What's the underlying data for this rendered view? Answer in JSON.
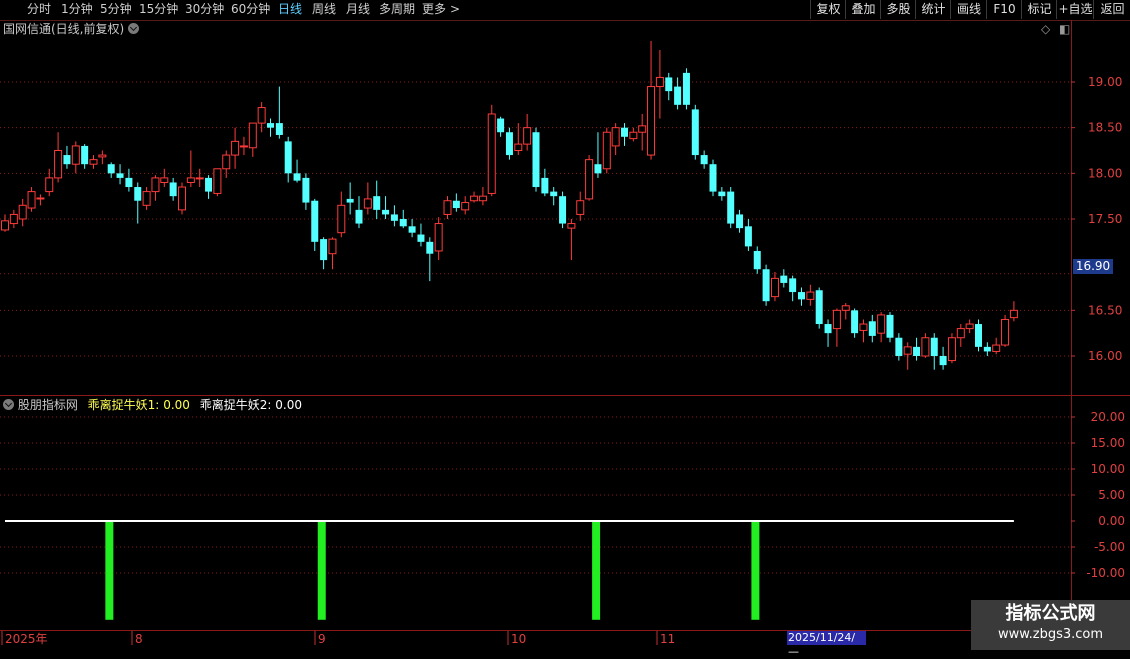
{
  "toolbar": {
    "periods": [
      {
        "label": "分时",
        "active": false
      },
      {
        "label": "1分钟",
        "active": false
      },
      {
        "label": "5分钟",
        "active": false
      },
      {
        "label": "15分钟",
        "active": false
      },
      {
        "label": "30分钟",
        "active": false
      },
      {
        "label": "60分钟",
        "active": false
      },
      {
        "label": "日线",
        "active": true
      },
      {
        "label": "周线",
        "active": false
      },
      {
        "label": "月线",
        "active": false
      },
      {
        "label": "多周期",
        "active": false
      },
      {
        "label": "更多",
        "active": false
      }
    ],
    "more_arrow": ">",
    "buttons": [
      "复权",
      "叠加",
      "多股",
      "统计",
      "画线",
      "F10",
      "标记",
      "+自选",
      "返回"
    ]
  },
  "main_panel": {
    "title": "国网信通(日线,前复权)",
    "price_axis": [
      "19.00",
      "18.50",
      "18.00",
      "17.50",
      "16.90",
      "16.50",
      "16.00"
    ],
    "current_price": "16.90",
    "icons": [
      "diamond-icon",
      "panel-toggle-icon"
    ]
  },
  "indicator_panel": {
    "name": "股朋指标网",
    "line1_label": "乖离捉牛妖1:",
    "line1_value": "0.00",
    "line2_label": "乖离捉牛妖2:",
    "line2_value": "0.00",
    "axis": [
      "20.00",
      "15.00",
      "10.00",
      "5.00",
      "0.00",
      "-5.00",
      "-10.00"
    ]
  },
  "date_axis": {
    "labels": [
      "2025年",
      "8",
      "9",
      "10",
      "11"
    ],
    "cursor": "2025/11/24/—"
  },
  "watermark": {
    "line1": "指标公式网",
    "line2": "www.zbgs3.com"
  },
  "colors": {
    "up": "#ff3b3b",
    "down": "#54ffff",
    "signal": "#22ee22",
    "grid": "#8a1a1a",
    "axis_text": "#e04040",
    "active_tab": "#5fd0ff"
  },
  "chart_data": {
    "type": "candlestick",
    "y_range": [
      15.8,
      19.35
    ],
    "candles": [
      [
        17.38,
        17.48,
        17.36,
        17.55
      ],
      [
        17.45,
        17.55,
        17.4,
        17.6
      ],
      [
        17.5,
        17.65,
        17.42,
        17.72
      ],
      [
        17.62,
        17.8,
        17.58,
        17.85
      ],
      [
        17.72,
        17.73,
        17.65,
        17.77
      ],
      [
        17.8,
        17.95,
        17.75,
        18.05
      ],
      [
        17.95,
        18.25,
        17.9,
        18.45
      ],
      [
        18.2,
        18.1,
        18.05,
        18.3
      ],
      [
        18.1,
        18.3,
        18.0,
        18.35
      ],
      [
        18.3,
        18.1,
        18.05,
        18.32
      ],
      [
        18.1,
        18.15,
        18.05,
        18.2
      ],
      [
        18.18,
        18.2,
        18.1,
        18.25
      ],
      [
        18.1,
        18.0,
        17.95,
        18.12
      ],
      [
        18.0,
        17.95,
        17.88,
        18.1
      ],
      [
        17.95,
        17.85,
        17.8,
        18.05
      ],
      [
        17.85,
        17.7,
        17.45,
        17.9
      ],
      [
        17.65,
        17.8,
        17.6,
        17.85
      ],
      [
        17.8,
        17.95,
        17.7,
        17.98
      ],
      [
        17.9,
        17.95,
        17.85,
        18.05
      ],
      [
        17.9,
        17.75,
        17.7,
        17.95
      ],
      [
        17.6,
        17.85,
        17.55,
        17.9
      ],
      [
        17.9,
        17.95,
        17.85,
        18.25
      ],
      [
        17.95,
        17.95,
        17.85,
        18.05
      ],
      [
        17.95,
        17.8,
        17.72,
        17.98
      ],
      [
        17.78,
        18.05,
        17.75,
        18.05
      ],
      [
        18.05,
        18.2,
        17.95,
        18.25
      ],
      [
        18.2,
        18.35,
        18.05,
        18.5
      ],
      [
        18.3,
        18.3,
        18.2,
        18.4
      ],
      [
        18.28,
        18.55,
        18.18,
        18.55
      ],
      [
        18.55,
        18.72,
        18.45,
        18.78
      ],
      [
        18.55,
        18.5,
        18.4,
        18.6
      ],
      [
        18.55,
        18.42,
        18.38,
        18.95
      ],
      [
        18.35,
        18.0,
        17.9,
        18.4
      ],
      [
        18.0,
        17.92,
        17.9,
        18.15
      ],
      [
        17.95,
        17.68,
        17.6,
        18.0
      ],
      [
        17.7,
        17.25,
        17.15,
        17.72
      ],
      [
        17.28,
        17.05,
        16.95,
        17.3
      ],
      [
        17.12,
        17.28,
        16.95,
        17.3
      ],
      [
        17.35,
        17.65,
        17.3,
        17.8
      ],
      [
        17.72,
        17.68,
        17.55,
        17.9
      ],
      [
        17.6,
        17.45,
        17.4,
        17.75
      ],
      [
        17.62,
        17.72,
        17.55,
        17.9
      ],
      [
        17.75,
        17.6,
        17.5,
        17.92
      ],
      [
        17.6,
        17.55,
        17.5,
        17.75
      ],
      [
        17.55,
        17.48,
        17.42,
        17.65
      ],
      [
        17.5,
        17.42,
        17.4,
        17.6
      ],
      [
        17.42,
        17.35,
        17.3,
        17.5
      ],
      [
        17.33,
        17.25,
        17.2,
        17.45
      ],
      [
        17.25,
        17.12,
        16.82,
        17.3
      ],
      [
        17.15,
        17.45,
        17.05,
        17.52
      ],
      [
        17.55,
        17.7,
        17.5,
        17.75
      ],
      [
        17.7,
        17.62,
        17.58,
        17.78
      ],
      [
        17.6,
        17.68,
        17.55,
        17.75
      ],
      [
        17.7,
        17.75,
        17.68,
        17.8
      ],
      [
        17.7,
        17.75,
        17.65,
        17.85
      ],
      [
        17.78,
        18.65,
        17.75,
        18.75
      ],
      [
        18.6,
        18.45,
        18.4,
        18.62
      ],
      [
        18.45,
        18.2,
        18.15,
        18.5
      ],
      [
        18.25,
        18.32,
        18.2,
        18.55
      ],
      [
        18.32,
        18.5,
        18.25,
        18.65
      ],
      [
        18.45,
        17.85,
        17.8,
        18.5
      ],
      [
        17.95,
        17.78,
        17.75,
        18.05
      ],
      [
        17.8,
        17.75,
        17.65,
        17.85
      ],
      [
        17.75,
        17.45,
        17.4,
        17.8
      ],
      [
        17.4,
        17.45,
        17.05,
        17.5
      ],
      [
        17.55,
        17.7,
        17.48,
        17.8
      ],
      [
        17.72,
        18.15,
        17.7,
        18.2
      ],
      [
        18.1,
        18.0,
        17.95,
        18.45
      ],
      [
        18.05,
        18.45,
        18.0,
        18.5
      ],
      [
        18.3,
        18.5,
        18.2,
        18.55
      ],
      [
        18.5,
        18.4,
        18.3,
        18.55
      ],
      [
        18.38,
        18.45,
        18.35,
        18.5
      ],
      [
        18.45,
        18.52,
        18.25,
        18.65
      ],
      [
        18.2,
        18.95,
        18.15,
        19.45
      ],
      [
        18.95,
        19.05,
        18.6,
        19.35
      ],
      [
        19.05,
        18.9,
        18.8,
        19.1
      ],
      [
        18.95,
        18.75,
        18.7,
        19.05
      ],
      [
        19.1,
        18.75,
        18.7,
        19.15
      ],
      [
        18.7,
        18.2,
        18.15,
        18.75
      ],
      [
        18.2,
        18.1,
        18.05,
        18.25
      ],
      [
        18.1,
        17.8,
        17.75,
        18.15
      ],
      [
        17.8,
        17.75,
        17.7,
        17.85
      ],
      [
        17.8,
        17.45,
        17.4,
        17.85
      ],
      [
        17.55,
        17.4,
        17.35,
        17.6
      ],
      [
        17.42,
        17.2,
        17.15,
        17.5
      ],
      [
        17.15,
        16.95,
        16.9,
        17.2
      ],
      [
        16.95,
        16.6,
        16.55,
        17.0
      ],
      [
        16.65,
        16.85,
        16.6,
        16.92
      ],
      [
        16.88,
        16.8,
        16.75,
        16.95
      ],
      [
        16.85,
        16.7,
        16.6,
        16.88
      ],
      [
        16.7,
        16.62,
        16.55,
        16.75
      ],
      [
        16.62,
        16.7,
        16.55,
        16.78
      ],
      [
        16.72,
        16.35,
        16.3,
        16.75
      ],
      [
        16.35,
        16.25,
        16.1,
        16.4
      ],
      [
        16.3,
        16.5,
        16.1,
        16.52
      ],
      [
        16.5,
        16.55,
        16.4,
        16.58
      ],
      [
        16.5,
        16.25,
        16.2,
        16.52
      ],
      [
        16.28,
        16.35,
        16.15,
        16.4
      ],
      [
        16.38,
        16.22,
        16.15,
        16.45
      ],
      [
        16.25,
        16.45,
        16.15,
        16.48
      ],
      [
        16.45,
        16.2,
        16.15,
        16.48
      ],
      [
        16.2,
        16.0,
        15.95,
        16.25
      ],
      [
        16.02,
        16.1,
        15.85,
        16.15
      ],
      [
        16.1,
        16.0,
        15.95,
        16.2
      ],
      [
        16.0,
        16.2,
        15.98,
        16.25
      ],
      [
        16.2,
        16.0,
        15.85,
        16.25
      ],
      [
        16.0,
        15.9,
        15.85,
        16.1
      ],
      [
        15.95,
        16.2,
        15.92,
        16.25
      ],
      [
        16.2,
        16.3,
        16.1,
        16.35
      ],
      [
        16.3,
        16.35,
        16.25,
        16.4
      ],
      [
        16.35,
        16.1,
        16.05,
        16.4
      ],
      [
        16.1,
        16.05,
        16.0,
        16.15
      ],
      [
        16.05,
        16.12,
        16.02,
        16.2
      ],
      [
        16.12,
        16.4,
        16.1,
        16.45
      ],
      [
        16.42,
        16.5,
        16.38,
        16.6
      ]
    ],
    "indicator": {
      "y_range": [
        -13.5,
        23
      ],
      "baseline": 0,
      "signals": [
        {
          "index": 11,
          "value": -19
        },
        {
          "index": 35,
          "value": -19
        },
        {
          "index": 66,
          "value": -19
        },
        {
          "index": 84,
          "value": -19
        }
      ]
    }
  }
}
